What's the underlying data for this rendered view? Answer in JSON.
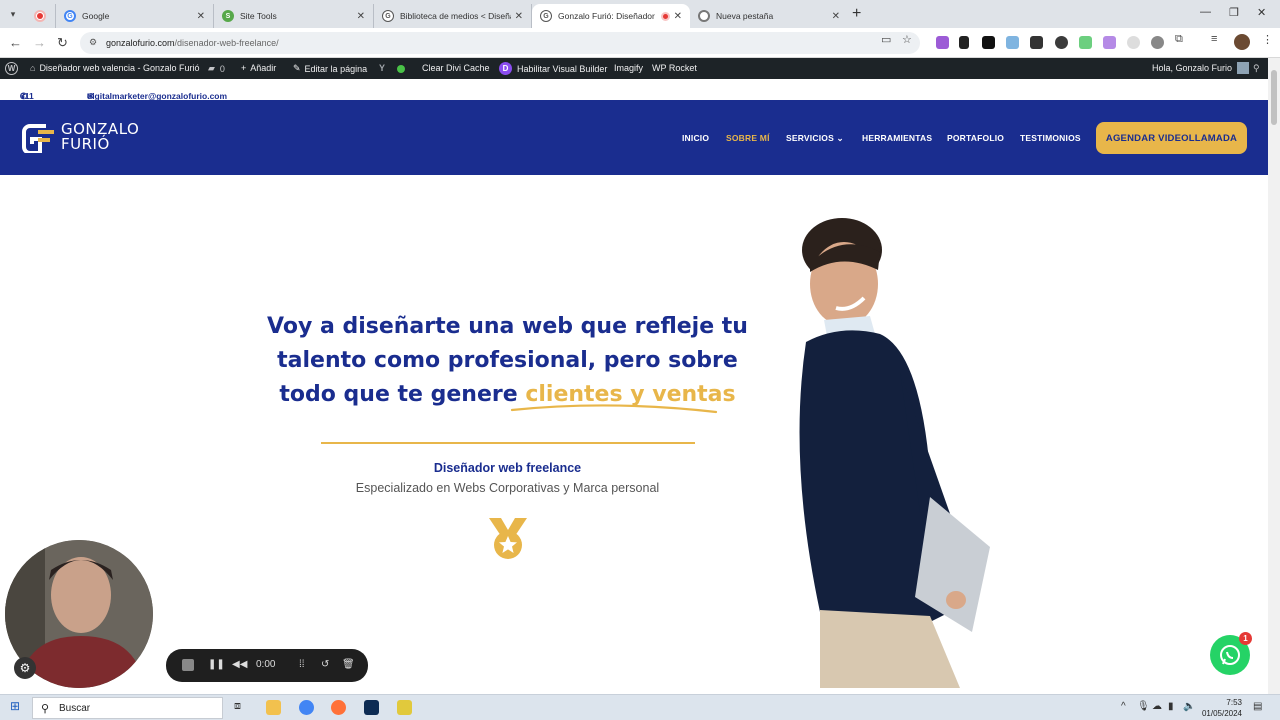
{
  "browser": {
    "tabs": [
      {
        "title": "",
        "favicon": "recording-icon"
      },
      {
        "title": "Google",
        "favicon": "google-icon"
      },
      {
        "title": "Site Tools",
        "favicon": "site-tools-icon"
      },
      {
        "title": "Biblioteca de medios < Diseña",
        "favicon": "gf-icon"
      },
      {
        "title": "Gonzalo Furió: Diseñador w",
        "favicon": "gf-icon",
        "active": true
      },
      {
        "title": "Nueva pestaña",
        "favicon": "chrome-icon"
      }
    ],
    "url_domain": "gonzalofurio.com",
    "url_path": "/disenador-web-freelance/"
  },
  "wp_admin_bar": {
    "site_name": "Diseñador web valencia - Gonzalo Furió",
    "comments_count": "0",
    "add_new": "Añadir",
    "edit_page": "Editar la página",
    "clear_cache": "Clear Divi Cache",
    "visual_builder": "Habilitar Visual Builder",
    "imagify": "Imagify",
    "wp_rocket": "WP Rocket",
    "greeting": "Hola, Gonzalo Furio"
  },
  "contact": {
    "phone": "611 77 87 32",
    "email": "digitalmarketer@gonzalofurio.com"
  },
  "header": {
    "logo_line1": "GONZALO",
    "logo_line2": "FURIÓ",
    "nav": [
      {
        "label": "INICIO"
      },
      {
        "label": "SOBRE MÍ",
        "current": true
      },
      {
        "label": "SERVICIOS"
      },
      {
        "label": "HERRAMIENTAS"
      },
      {
        "label": "PORTAFOLIO"
      },
      {
        "label": "TESTIMONIOS"
      }
    ],
    "cta": "AGENDAR VIDEOLLAMADA"
  },
  "hero": {
    "title_line1": "Voy a diseñarte una web que refleje tu",
    "title_line2": "talento como profesional, pero sobre",
    "title_line3": "todo que te genere",
    "title_highlight": "clientes y ventas",
    "subtitle": "Diseñador web freelance",
    "subtext": "Especializado en Webs Corporativas y Marca personal"
  },
  "recorder": {
    "time": "0:00"
  },
  "whatsapp": {
    "badge": "1"
  },
  "taskbar": {
    "search_label": "Buscar",
    "time": "7:53",
    "date": "01/05/2024"
  },
  "colors": {
    "brand_blue": "#1a2d8f",
    "brand_gold": "#e8b64a",
    "wp_bar": "#1d2327"
  }
}
